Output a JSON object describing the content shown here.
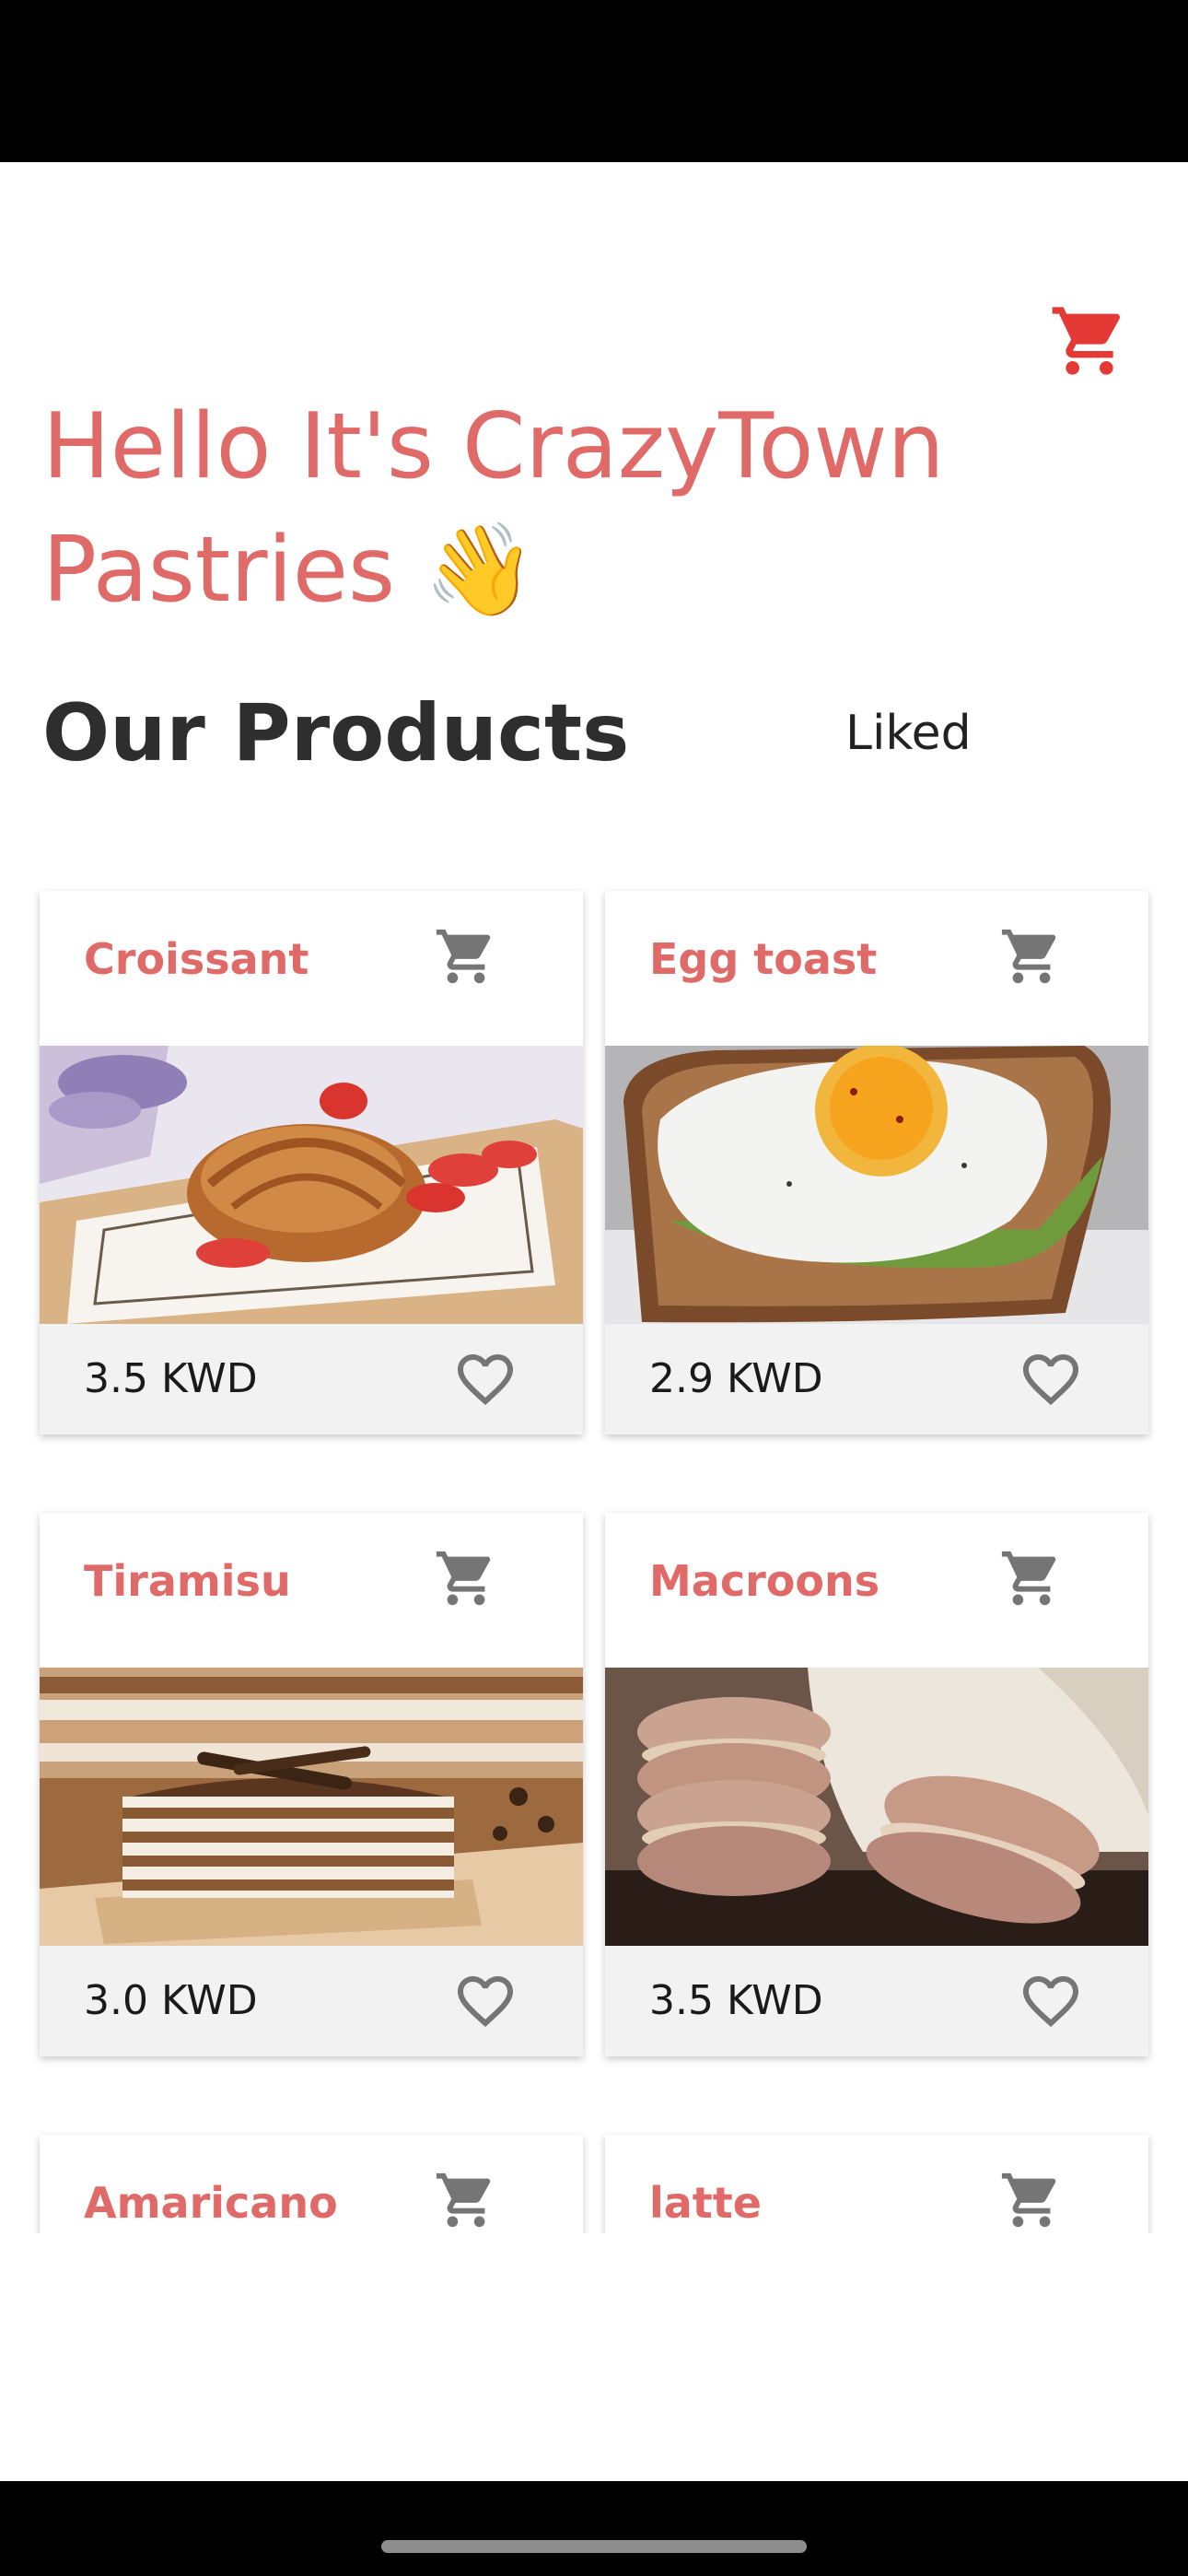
{
  "header": {
    "greeting": "Hello It's CrazyTown Pastries 👋",
    "cart_icon": "shopping-cart-icon",
    "accent_color": "#e06a68"
  },
  "section": {
    "title": "Our Products",
    "liked_tab": "Liked"
  },
  "products": [
    {
      "name": "Croissant",
      "price": "3.5 KWD"
    },
    {
      "name": "Egg toast",
      "price": "2.9 KWD"
    },
    {
      "name": "Tiramisu",
      "price": "3.0 KWD"
    },
    {
      "name": "Macroons",
      "price": "3.5 KWD"
    },
    {
      "name": "Amaricano"
    },
    {
      "name": "latte"
    }
  ],
  "icons": {
    "card_cart": "shopping-cart-icon",
    "card_like": "heart-outline-icon"
  }
}
